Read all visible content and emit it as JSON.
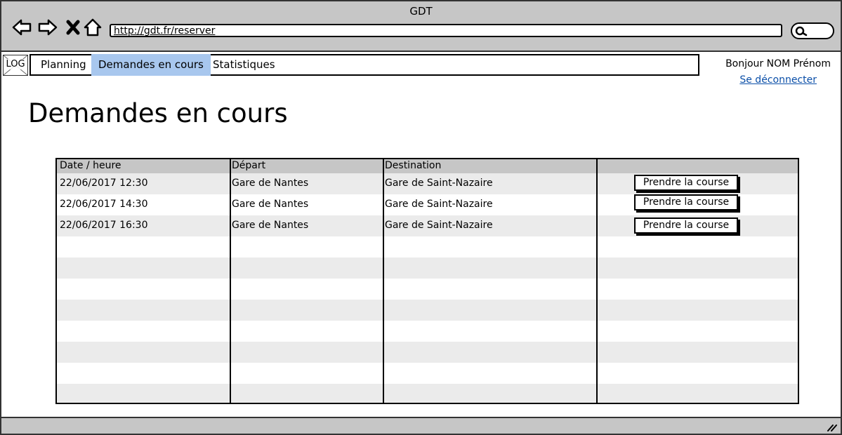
{
  "browser": {
    "title": "GDT",
    "url": "http://gdt.fr/reserver"
  },
  "nav": {
    "logo": "LOG",
    "items": [
      "Planning",
      "Demandes en cours",
      "Statistiques"
    ],
    "active": "Demandes en cours"
  },
  "user": {
    "greeting": "Bonjour NOM Prénom",
    "logout": "Se déconnecter"
  },
  "page": {
    "title": "Demandes en cours"
  },
  "table": {
    "columns": [
      "Date / heure",
      "Départ",
      "Destination",
      ""
    ],
    "rows": [
      {
        "datetime": "22/06/2017 12:30",
        "depart": "Gare de Nantes",
        "destination": "Gare de Saint-Nazaire",
        "action": "Prendre la course"
      },
      {
        "datetime": "22/06/2017 14:30",
        "depart": "Gare de Nantes",
        "destination": "Gare de Saint-Nazaire",
        "action": "Prendre la course"
      },
      {
        "datetime": "22/06/2017 16:30",
        "depart": "Gare de Nantes",
        "destination": "Gare de Saint-Nazaire",
        "action": "Prendre la course"
      }
    ]
  },
  "colors": {
    "active_tab": "#a8c7ee",
    "chrome": "#c6c6c6",
    "stripe": "#ebebeb",
    "link": "#0b4fa8"
  }
}
